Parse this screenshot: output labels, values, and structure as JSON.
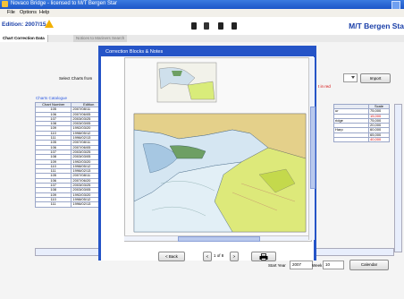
{
  "window": {
    "title": "Novaco Bridge - licensed to M/T Bergen Star"
  },
  "menu": [
    "File",
    "Options",
    "Help"
  ],
  "toolbar": {
    "edition": "Edition: 2007/15",
    "ship_name": "M/T Bergen Sta"
  },
  "tabs": [
    "Chart Correction Data",
    "Notices to Mariners Search"
  ],
  "panel": {
    "select_charts_label": "Select Charts from",
    "import_label": "Import",
    "in_red_note": "t in red",
    "catalogue_title": "Charts Catalogue",
    "catalogue_headers": [
      "Chart Number",
      "Edition"
    ],
    "catalogue_rows": [
      [
        "105",
        "2007/08/11"
      ],
      [
        "106",
        "2007/06/05"
      ],
      [
        "107",
        "2003/03/25"
      ],
      [
        "108",
        "2003/03/05"
      ],
      [
        "109",
        "1992/03/20"
      ],
      [
        "110",
        "1998/05/12"
      ],
      [
        "111",
        "1996/02/13"
      ],
      [
        "105",
        "2007/08/11"
      ],
      [
        "106",
        "2007/06/05"
      ],
      [
        "107",
        "2003/03/25"
      ],
      [
        "108",
        "2003/03/05"
      ],
      [
        "109",
        "1992/03/20"
      ],
      [
        "110",
        "1998/05/12"
      ],
      [
        "111",
        "1996/02/13"
      ],
      [
        "105",
        "2007/08/11"
      ],
      [
        "106",
        "2007/06/20"
      ],
      [
        "107",
        "2003/03/25"
      ],
      [
        "108",
        "2003/03/05"
      ],
      [
        "109",
        "1992/03/20"
      ],
      [
        "110",
        "1998/05/12"
      ],
      [
        "111",
        "1996/02/13"
      ]
    ],
    "right_header": "Scale",
    "right_rows": [
      [
        "ur",
        "75,000"
      ],
      [
        "",
        "15,000"
      ],
      [
        "ridge",
        "75,000"
      ],
      [
        "",
        "20,000"
      ],
      [
        "Harp",
        "60,000"
      ],
      [
        "",
        "65,000"
      ],
      [
        "",
        "40,000"
      ]
    ],
    "start_year_label": "Start Year",
    "start_year_value": "2007",
    "week_label": "Week",
    "week_value": "10",
    "calendar_label": "Calendar"
  },
  "dialog": {
    "title": "Correction Blocks & Notes",
    "back_label": "< Back",
    "prev_label": "<",
    "page_label": "1 of 8",
    "next_label": ">"
  },
  "colors": {
    "title_blue": "#1a3fa8",
    "dialog_border": "#2554c7",
    "red_text": "#d40000"
  }
}
